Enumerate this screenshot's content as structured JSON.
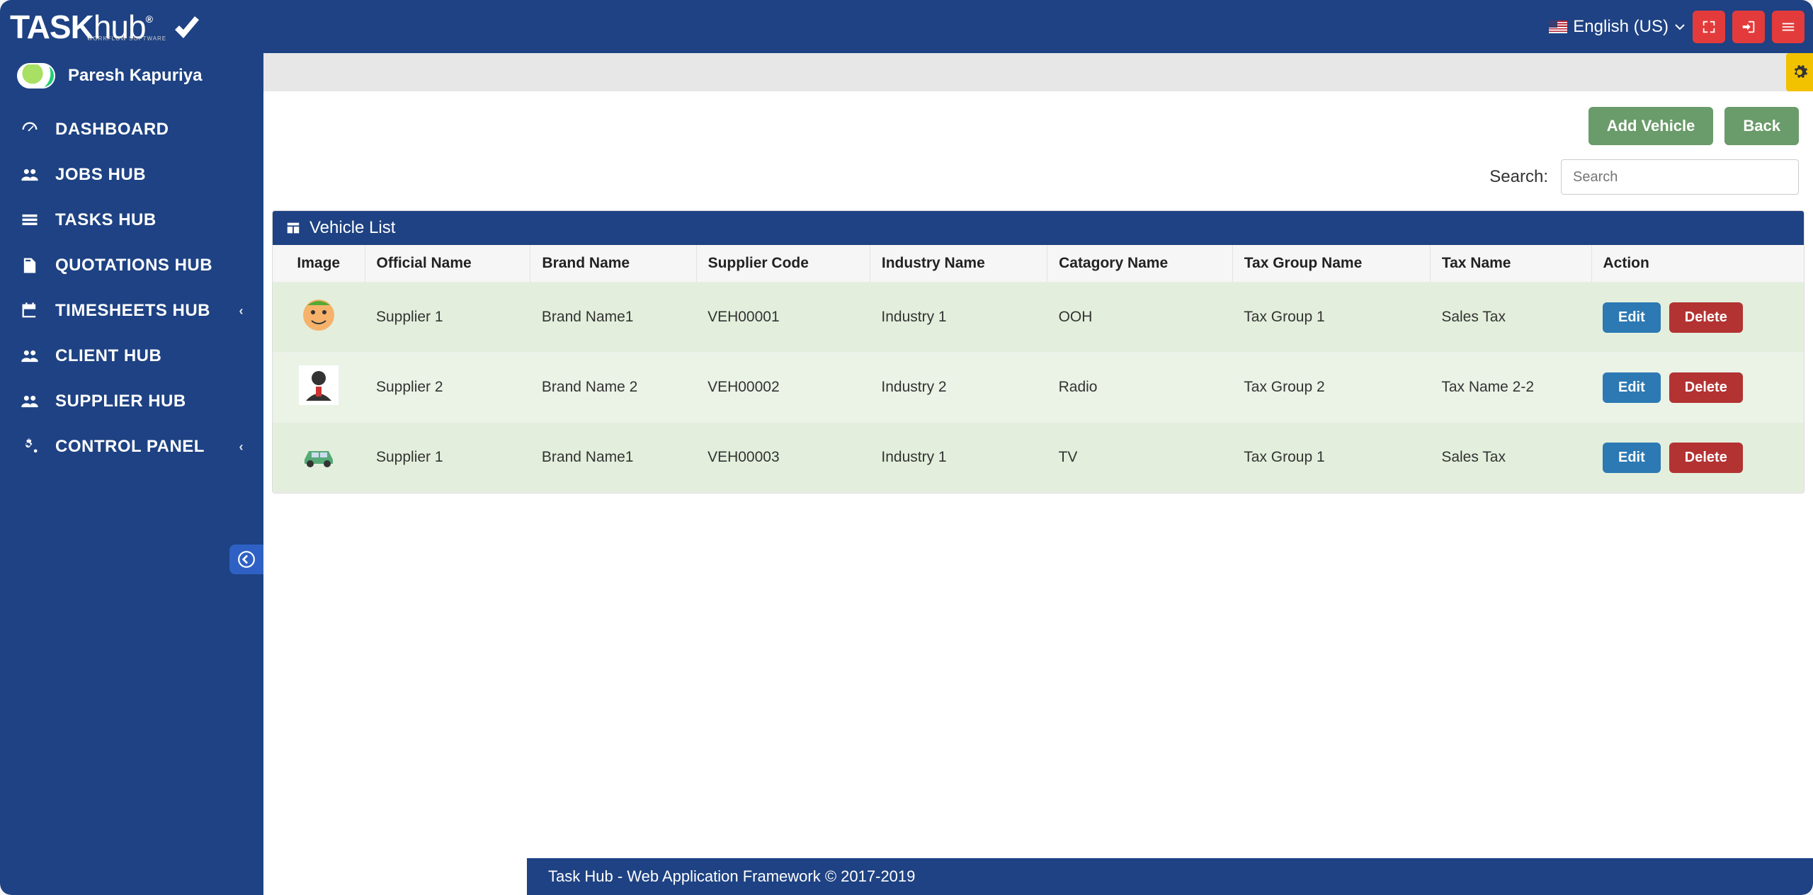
{
  "brand": {
    "name": "TASKhub",
    "tagline": "WORKFLOW SOFTWARE"
  },
  "topbar": {
    "language": "English (US)"
  },
  "user": {
    "name": "Paresh Kapuriya"
  },
  "sidebar": {
    "items": [
      {
        "label": "DASHBOARD",
        "icon": "dashboard",
        "chev": false
      },
      {
        "label": "JOBS HUB",
        "icon": "users",
        "chev": false
      },
      {
        "label": "TASKS HUB",
        "icon": "list",
        "chev": false
      },
      {
        "label": "QUOTATIONS HUB",
        "icon": "document",
        "chev": false
      },
      {
        "label": "TIMESHEETS HUB",
        "icon": "calendar",
        "chev": true
      },
      {
        "label": "CLIENT HUB",
        "icon": "users",
        "chev": false
      },
      {
        "label": "SUPPLIER HUB",
        "icon": "users",
        "chev": false
      },
      {
        "label": "CONTROL PANEL",
        "icon": "cogs",
        "chev": true
      }
    ]
  },
  "actions": {
    "add": "Add Vehicle",
    "back": "Back"
  },
  "search": {
    "label": "Search:",
    "placeholder": "Search"
  },
  "panel": {
    "title": "Vehicle List"
  },
  "table": {
    "headers": [
      "Image",
      "Official Name",
      "Brand Name",
      "Supplier Code",
      "Industry Name",
      "Catagory Name",
      "Tax Group Name",
      "Tax Name",
      "Action"
    ],
    "rows": [
      {
        "img": "face",
        "official": "Supplier 1",
        "brand": "Brand Name1",
        "code": "VEH00001",
        "industry": "Industry 1",
        "category": "OOH",
        "taxgroup": "Tax Group 1",
        "tax": "Sales Tax"
      },
      {
        "img": "person",
        "official": "Supplier 2",
        "brand": "Brand Name 2",
        "code": "VEH00002",
        "industry": "Industry 2",
        "category": "Radio",
        "taxgroup": "Tax Group 2",
        "tax": "Tax Name 2-2"
      },
      {
        "img": "car",
        "official": "Supplier 1",
        "brand": "Brand Name1",
        "code": "VEH00003",
        "industry": "Industry 1",
        "category": "TV",
        "taxgroup": "Tax Group 1",
        "tax": "Sales Tax"
      }
    ],
    "edit": "Edit",
    "delete": "Delete"
  },
  "footer": "Task Hub - Web Application Framework © 2017-2019"
}
